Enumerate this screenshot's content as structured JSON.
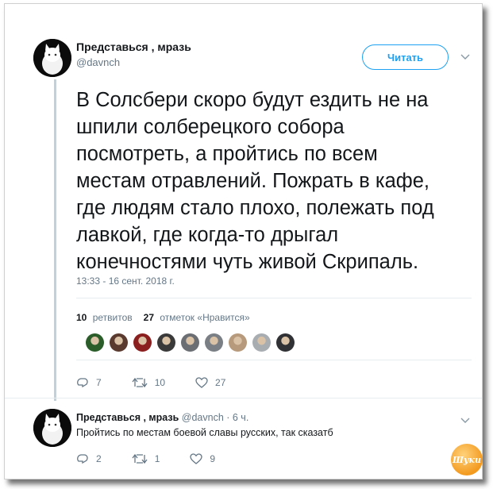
{
  "tweet": {
    "author_name": "Представься , мразь",
    "handle": "@davnch",
    "follow_label": "Читать",
    "text": "В Солсбери скоро будут ездить не на\nшпили солберецкого собора\nпосмотреть, а пройтись по всем\nместам отравлений. Пожрать в кафе,\nгде людям стало плохо, полежать под\nлавкой, где когда-то дрыгал\nконечностями чуть живой Скрипаль.",
    "timestamp": "13:33 - 16 сент. 2018 г.",
    "retweets_count": "10",
    "retweets_label": "ретвитов",
    "likes_count": "27",
    "likes_label": "отметок «Нравится»",
    "replies": "7",
    "retweets_action": "10",
    "likes_action": "27"
  },
  "reply": {
    "author_name": "Представься , мразь",
    "handle_time": "@davnch · 6 ч.",
    "text": "Пройтись по местам боевой славы русских, так сказатб",
    "replies": "2",
    "retweets": "1",
    "likes": "9"
  },
  "watermark": "Шуки",
  "colors": {
    "accent": "#1da1f2",
    "muted": "#657786",
    "border": "#e6ecf0"
  },
  "liker_avatars": [
    "#2b5d2a",
    "#5a3a2e",
    "#8b1e1e",
    "#3a3a3a",
    "#6b6f74",
    "#7a7f85",
    "#b79a7c",
    "#a8adb2",
    "#2f3134"
  ]
}
